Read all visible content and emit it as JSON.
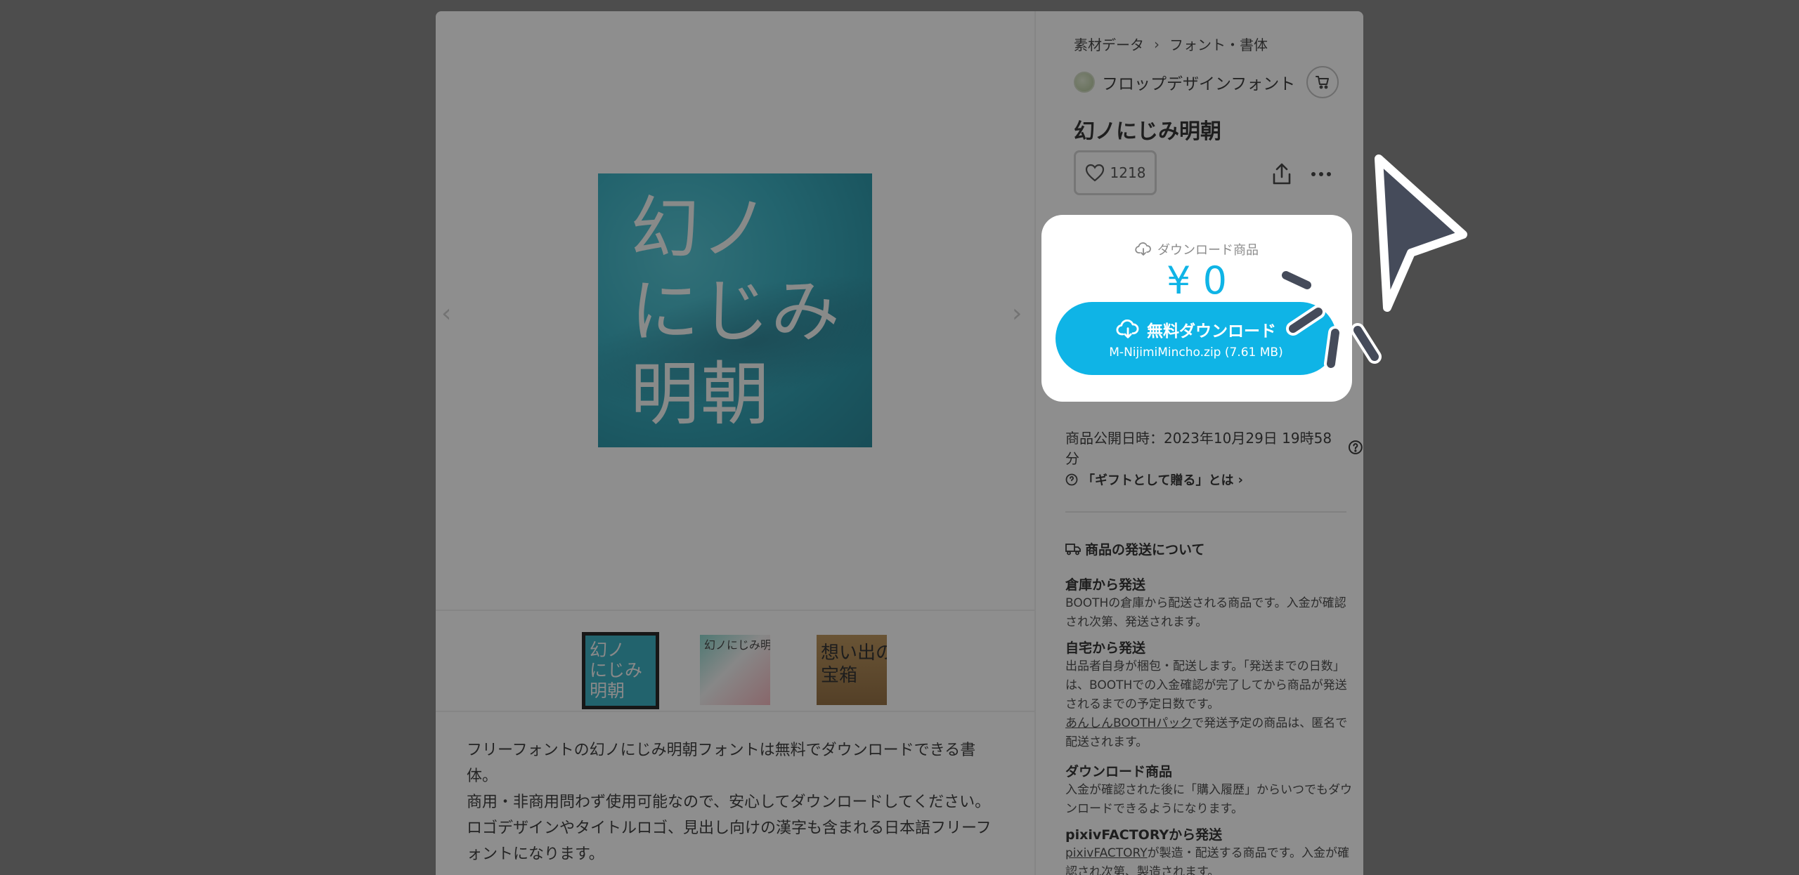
{
  "breadcrumb": {
    "category": "素材データ",
    "subcategory": "フォント・書体"
  },
  "shop": {
    "name": "フロップデザインフォント"
  },
  "product": {
    "title": "幻ノにじみ明朝",
    "likes": "1218",
    "main_image_text": "幻ノ\nにじみ\n明朝"
  },
  "gallery": {
    "prev_arrow": "‹",
    "next_arrow": "›",
    "thumbs": [
      {
        "text": "幻ノ\nにじみ\n明朝"
      },
      {
        "text": "幻ノにじみ明朝"
      },
      {
        "text": "想い出の\n宝箱"
      }
    ]
  },
  "purchase": {
    "type_label": "ダウンロード商品",
    "price": "¥ 0",
    "download_label": "無料ダウンロード",
    "file_info": "M-NijimiMincho.zip (7.61 MB)"
  },
  "info": {
    "published": "商品公開日時：2023年10月29日 19時58分",
    "gift_link": "「ギフトとして贈る」とは",
    "shipping_heading": "商品の発送について",
    "shipping": [
      {
        "title": "倉庫から発送",
        "text": "BOOTHの倉庫から配送される商品です。入金が確認され次第、発送されます。"
      },
      {
        "title": "自宅から発送",
        "text": "出品者自身が梱包・配送します。「発送までの日数」は、BOOTHでの入金確認が完了してから商品が発送されるまでの予定日数です。",
        "link": "あんしんBOOTHパック",
        "link_suffix": "で発送予定の商品は、匿名で配送されます。"
      },
      {
        "title": "ダウンロード商品",
        "text": "入金が確認された後に「購入履歴」からいつでもダウンロードできるようになります。"
      },
      {
        "title": "pixivFACTORYから発送",
        "link": "pixivFACTORY",
        "text": "が製造・配送する商品です。入金が確認され次第、製造されます。"
      }
    ]
  },
  "description": [
    "フリーフォントの幻ノにじみ明朝フォントは無料でダウンロードできる書体。",
    "商用・非商用問わず使用可能なので、安心してダウンロードしてください。",
    "ロゴデザインやタイトルロゴ、見出し向けの漢字も含まれる日本語フリーフォントになります。"
  ],
  "colors": {
    "accent": "#0fb4e6",
    "overlay": "rgba(30,30,30,0.5)",
    "cursor": "#454b5a"
  }
}
